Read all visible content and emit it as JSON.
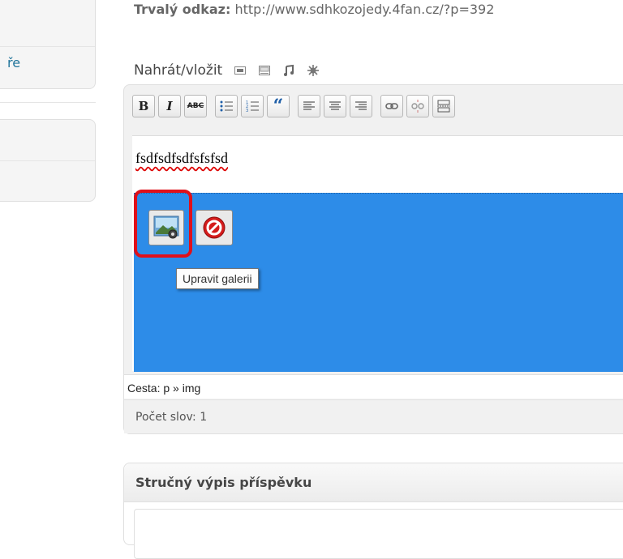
{
  "sidebar": {
    "partial_label": "ře"
  },
  "permalink": {
    "label": "Trvalý odkaz:",
    "url": "http://www.sdhkozojedy.4fan.cz/?p=392"
  },
  "media": {
    "label": "Nahrát/vložit",
    "icons": [
      "image-icon",
      "video-icon",
      "audio-icon",
      "media-icon"
    ]
  },
  "toolbar": {
    "buttons": [
      {
        "name": "bold",
        "label": "B"
      },
      {
        "name": "italic",
        "label": "I"
      },
      {
        "name": "strikethrough",
        "label": "ABC"
      },
      {
        "name": "bullet-list",
        "label": "☰"
      },
      {
        "name": "numbered-list",
        "label": "☰"
      },
      {
        "name": "blockquote",
        "label": "“"
      },
      {
        "name": "align-left",
        "label": "≡"
      },
      {
        "name": "align-center",
        "label": "≡"
      },
      {
        "name": "align-right",
        "label": "≡"
      },
      {
        "name": "link",
        "label": "⚭"
      },
      {
        "name": "unlink",
        "label": "⚮"
      },
      {
        "name": "more",
        "label": "▭"
      }
    ]
  },
  "editor": {
    "content_text": "fsdfsdfsdfsfsfsd",
    "tooltip": "Upravit galerii",
    "path_text": "Cesta: p » img",
    "word_count": "Počet slov: 1"
  },
  "excerpt": {
    "title": "Stručný výpis příspěvku"
  },
  "colors": {
    "selection": "#2d8ce8",
    "highlight": "#e0101a",
    "link": "#21759b"
  }
}
